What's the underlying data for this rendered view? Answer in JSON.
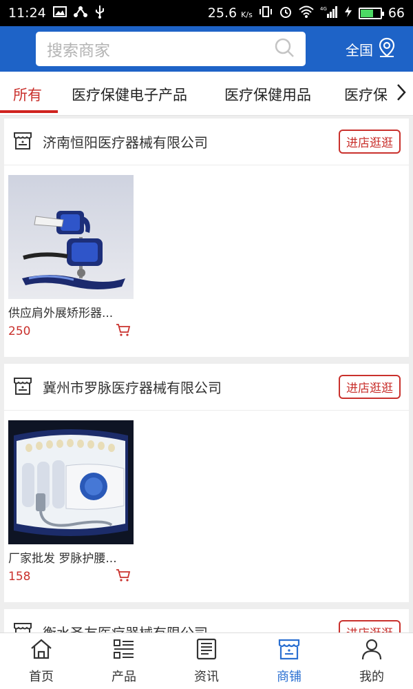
{
  "status_bar": {
    "time": "11:24",
    "net_speed": "25.6",
    "net_unit": "K/s",
    "battery": "66",
    "battery_level": 0.66,
    "signal_label": "4G"
  },
  "header": {
    "search_placeholder": "搜索商家",
    "region_label": "全国"
  },
  "tabs": [
    {
      "label": "所有"
    },
    {
      "label": "医疗保健电子产品"
    },
    {
      "label": "医疗保健用品"
    },
    {
      "label": "医疗保"
    }
  ],
  "shops": [
    {
      "name": "济南恒阳医疗器械有限公司",
      "visit_label": "进店逛逛",
      "product": {
        "name": "供应肩外展矫形器...",
        "price": "250"
      }
    },
    {
      "name": "冀州市罗脉医疗器械有限公司",
      "visit_label": "进店逛逛",
      "product": {
        "name": "厂家批发 罗脉护腰...",
        "price": "158"
      }
    },
    {
      "name": "衡水圣友医疗器械有限公司",
      "visit_label": "进店逛逛"
    }
  ],
  "bottom_nav": [
    {
      "label": "首页",
      "icon": "home-icon"
    },
    {
      "label": "产品",
      "icon": "list-icon"
    },
    {
      "label": "资讯",
      "icon": "news-icon"
    },
    {
      "label": "商铺",
      "icon": "shop-icon"
    },
    {
      "label": "我的",
      "icon": "user-icon"
    }
  ],
  "colors": {
    "header_blue": "#1e63c7",
    "accent_red": "#c9302c",
    "nav_active": "#2a6fd1"
  }
}
